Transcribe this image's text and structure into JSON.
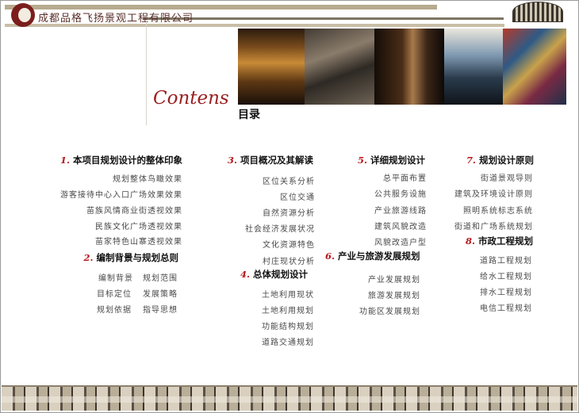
{
  "header": {
    "company": "成都品格飞扬景观工程有限公司",
    "logo_icon": "company-logo-icon",
    "emblem_icon": "ornament-emblem-icon"
  },
  "title": {
    "contens": "Contens",
    "mulu": "目录"
  },
  "sections": [
    {
      "num": "1.",
      "title": "本项目规划设计的整体印象",
      "items": [
        "规划整体鸟瞰效果",
        "游客接待中心入口广场效果效果",
        "苗族风情商业街透视效果",
        "民族文化广场透视效果",
        "苗家特色山寨透视效果"
      ]
    },
    {
      "num": "2.",
      "title": "编制背景与规划总则",
      "items": [
        "编制背景",
        "规划范围",
        "目标定位",
        "发展策略",
        "规划依据",
        "指导思想"
      ]
    },
    {
      "num": "3.",
      "title": "项目概况及其解读",
      "items": [
        "区位关系分析",
        "区位交通",
        "自然资源分析",
        "社会经济发展状况",
        "文化资源特色",
        "村庄现状分析"
      ]
    },
    {
      "num": "4.",
      "title": "总体规划设计",
      "items": [
        "土地利用现状",
        "土地利用规划",
        "功能结构规划",
        "道路交通规划"
      ]
    },
    {
      "num": "5.",
      "title": "详细规划设计",
      "items": [
        "总平面布置",
        "公共服务设施",
        "产业旅游线路",
        "建筑风貌改造",
        "风貌改造户型"
      ]
    },
    {
      "num": "6.",
      "title": "产业与旅游发展规划",
      "items": [
        "产业发展规划",
        "旅游发展规划",
        "功能区发展规划"
      ]
    },
    {
      "num": "7.",
      "title": "规划设计原则",
      "items": [
        "街道景观导则",
        "建筑及环境设计原则",
        "照明系统标志系统",
        "街道和广场系统规划"
      ]
    },
    {
      "num": "8.",
      "title": "市政工程规划",
      "items": [
        "道路工程规划",
        "给水工程规划",
        "排水工程规划",
        "电信工程规划"
      ]
    }
  ]
}
